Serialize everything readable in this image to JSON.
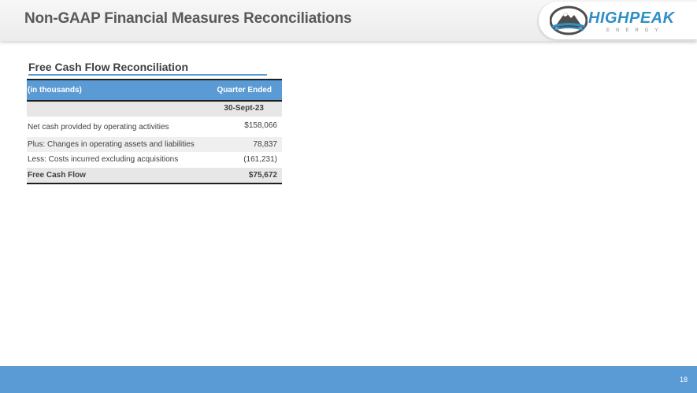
{
  "header": {
    "title": "Non-GAAP Financial Measures Reconciliations",
    "logo_name": "HIGHPEAK",
    "logo_sub": "ENERGY"
  },
  "section": {
    "title": "Free Cash Flow Reconciliation"
  },
  "table": {
    "unit_label": "(in thousands)",
    "period_label": "Quarter Ended",
    "period_date": "30-Sept-23",
    "rows": [
      {
        "label": "Net cash provided by operating activities",
        "value": "$158,066"
      },
      {
        "label": "Plus: Changes in operating assets and liabilities",
        "value": "78,837"
      },
      {
        "label": "Less: Costs incurred excluding acquisitions",
        "value": "(161,231)"
      },
      {
        "label": "Free Cash Flow",
        "value": "$75,672"
      }
    ]
  },
  "footer": {
    "page_number": "18"
  },
  "colors": {
    "accent_blue": "#5b9bd5",
    "logo_blue": "#2f8fc7",
    "title_gray": "#595959"
  }
}
